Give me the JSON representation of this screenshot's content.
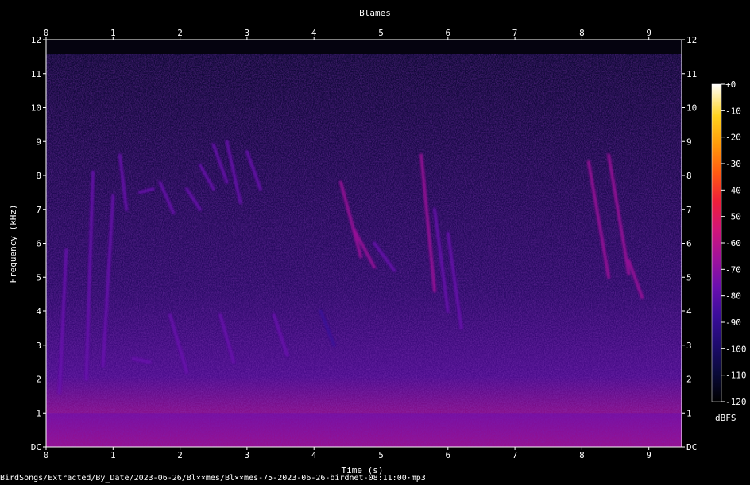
{
  "chart_data": {
    "type": "heatmap",
    "title": "Blames",
    "xlabel": "Time (s)",
    "ylabel": "Frequency (kHz)",
    "xlim": [
      0,
      9.5
    ],
    "ylim": [
      0,
      12
    ],
    "x_ticks": [
      "0",
      "1",
      "2",
      "3",
      "4",
      "5",
      "6",
      "7",
      "8",
      "9"
    ],
    "y_ticks": [
      "DC",
      "1",
      "2",
      "3",
      "4",
      "5",
      "6",
      "7",
      "8",
      "9",
      "10",
      "11",
      "12"
    ],
    "colorbar": {
      "label": "dBFS",
      "ticks": [
        "+0",
        "-10",
        "-20",
        "-30",
        "-40",
        "-50",
        "-60",
        "-70",
        "-80",
        "-90",
        "-100",
        "-110",
        "-120"
      ],
      "range_dbfs": [
        -120,
        0
      ],
      "colors": [
        "#000000",
        "#0a0a3a",
        "#1e0b6e",
        "#3a0d9a",
        "#6a0fb0",
        "#a0129c",
        "#d0157a",
        "#f01e3a",
        "#ff5a12",
        "#ff9a0a",
        "#ffd21e",
        "#ffffff"
      ]
    },
    "background_level_dbfs": -100,
    "low_frequency_band": {
      "freq_khz": [
        0,
        1.0
      ],
      "level_dbfs": -72
    },
    "calls": [
      {
        "t": [
          0.2,
          0.3
        ],
        "f": [
          1.6,
          5.8
        ],
        "level_dbfs": -80
      },
      {
        "t": [
          0.6,
          0.7
        ],
        "f": [
          2.0,
          8.1
        ],
        "level_dbfs": -78
      },
      {
        "t": [
          0.85,
          1.0
        ],
        "f": [
          2.4,
          7.4
        ],
        "level_dbfs": -76
      },
      {
        "t": [
          1.1,
          1.2
        ],
        "f": [
          8.6,
          7.0
        ],
        "level_dbfs": -78
      },
      {
        "t": [
          1.4,
          1.6
        ],
        "f": [
          7.5,
          7.6
        ],
        "level_dbfs": -80
      },
      {
        "t": [
          1.7,
          1.9
        ],
        "f": [
          7.8,
          6.9
        ],
        "level_dbfs": -78
      },
      {
        "t": [
          2.1,
          2.3
        ],
        "f": [
          7.6,
          7.0
        ],
        "level_dbfs": -78
      },
      {
        "t": [
          2.3,
          2.5
        ],
        "f": [
          8.3,
          7.6
        ],
        "level_dbfs": -74
      },
      {
        "t": [
          2.5,
          2.7
        ],
        "f": [
          8.9,
          7.8
        ],
        "level_dbfs": -72
      },
      {
        "t": [
          2.7,
          2.9
        ],
        "f": [
          9.0,
          7.2
        ],
        "level_dbfs": -74
      },
      {
        "t": [
          3.0,
          3.2
        ],
        "f": [
          8.7,
          7.6
        ],
        "level_dbfs": -76
      },
      {
        "t": [
          1.3,
          1.55
        ],
        "f": [
          2.6,
          2.5
        ],
        "level_dbfs": -74
      },
      {
        "t": [
          1.85,
          2.1
        ],
        "f": [
          3.9,
          2.2
        ],
        "level_dbfs": -76
      },
      {
        "t": [
          2.6,
          2.8
        ],
        "f": [
          3.9,
          2.5
        ],
        "level_dbfs": -80
      },
      {
        "t": [
          3.4,
          3.6
        ],
        "f": [
          3.9,
          2.7
        ],
        "level_dbfs": -80
      },
      {
        "t": [
          4.1,
          4.3
        ],
        "f": [
          4.0,
          3.0
        ],
        "level_dbfs": -82
      },
      {
        "t": [
          4.4,
          4.7
        ],
        "f": [
          7.8,
          5.6
        ],
        "level_dbfs": -66
      },
      {
        "t": [
          4.6,
          4.9
        ],
        "f": [
          6.4,
          5.3
        ],
        "level_dbfs": -70
      },
      {
        "t": [
          4.9,
          5.2
        ],
        "f": [
          6.0,
          5.2
        ],
        "level_dbfs": -72
      },
      {
        "t": [
          5.6,
          5.8
        ],
        "f": [
          8.6,
          4.6
        ],
        "level_dbfs": -66
      },
      {
        "t": [
          5.8,
          6.0
        ],
        "f": [
          7.0,
          4.0
        ],
        "level_dbfs": -72
      },
      {
        "t": [
          6.0,
          6.2
        ],
        "f": [
          6.3,
          3.5
        ],
        "level_dbfs": -76
      },
      {
        "t": [
          8.1,
          8.4
        ],
        "f": [
          8.4,
          5.0
        ],
        "level_dbfs": -66
      },
      {
        "t": [
          8.4,
          8.7
        ],
        "f": [
          8.6,
          5.1
        ],
        "level_dbfs": -70
      },
      {
        "t": [
          8.7,
          8.9
        ],
        "f": [
          5.5,
          4.4
        ],
        "level_dbfs": -70
      }
    ]
  },
  "footer": {
    "path": "BirdSongs/Extracted/By_Date/2023-06-26/Bl××mes/Bl××mes-75-2023-06-26-birdnet-08:11:00·mp3"
  }
}
